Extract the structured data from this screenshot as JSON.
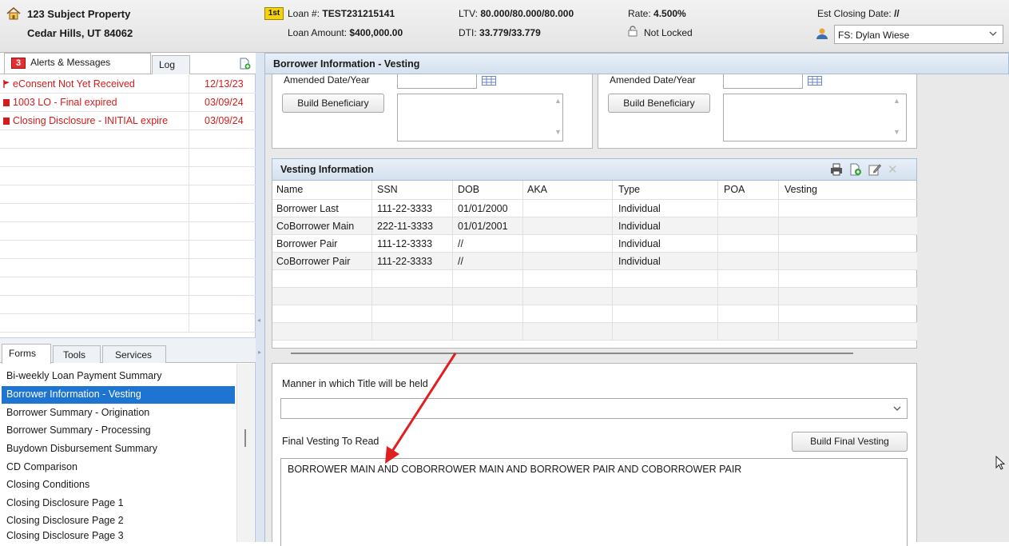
{
  "header": {
    "property_line1": "123 Subject Property",
    "property_line2": "Cedar Hills, UT 84062",
    "lien_badge": "1st",
    "loan_number_label": "Loan #:",
    "loan_number": "TEST231215141",
    "loan_amount_label": "Loan Amount:",
    "loan_amount": "$400,000.00",
    "ltv_label": "LTV:",
    "ltv": "80.000/80.000/80.000",
    "dti_label": "DTI:",
    "dti": "33.779/33.779",
    "rate_label": "Rate:",
    "rate": "4.500%",
    "lock_status": "Not Locked",
    "est_closing_label": "Est Closing Date:",
    "est_closing": "//",
    "user_select": "FS: Dylan Wiese"
  },
  "left_tabs": {
    "alerts_count": "3",
    "alerts_label": "Alerts & Messages",
    "log_label": "Log"
  },
  "alerts": [
    {
      "text": "eConsent Not Yet Received",
      "date": "12/13/23"
    },
    {
      "text": "1003 LO - Final expired",
      "date": "03/09/24"
    },
    {
      "text": "Closing Disclosure - INITIAL expire",
      "date": "03/09/24"
    }
  ],
  "bottom_tabs": {
    "forms": "Forms",
    "tools": "Tools",
    "services": "Services"
  },
  "forms": [
    "Bi-weekly Loan Payment Summary",
    "Borrower Information - Vesting",
    "Borrower Summary - Origination",
    "Borrower Summary - Processing",
    "Buydown Disbursement Summary",
    "CD Comparison",
    "Closing Conditions",
    "Closing Disclosure Page 1",
    "Closing Disclosure Page 2",
    "Closing Disclosure Page 3"
  ],
  "main": {
    "title": "Borrower Information - Vesting",
    "amended_label": "Amended Date/Year",
    "build_beneficiary": "Build Beneficiary",
    "vesting_title": "Vesting Information",
    "columns": [
      "Name",
      "SSN",
      "DOB",
      "AKA",
      "Type",
      "POA",
      "Vesting"
    ],
    "rows": [
      [
        "Borrower Last",
        "111-22-3333",
        "01/01/2000",
        "",
        "Individual",
        "",
        ""
      ],
      [
        "CoBorrower Main",
        "222-11-3333",
        "01/01/2001",
        "",
        "Individual",
        "",
        ""
      ],
      [
        "Borrower Pair",
        "111-12-3333",
        "//",
        "",
        "Individual",
        "",
        ""
      ],
      [
        "CoBorrower Pair",
        "111-22-3333",
        "//",
        "",
        "Individual",
        "",
        ""
      ]
    ],
    "manner_label": "Manner in which Title will be held",
    "manner_value": "",
    "final_vesting_label": "Final Vesting To Read",
    "build_final_vesting": "Build Final Vesting",
    "final_vesting_text": "BORROWER MAIN AND COBORROWER MAIN AND BORROWER PAIR AND COBORROWER PAIR"
  },
  "colors": {
    "alert_red": "#d41c1c",
    "selection_blue": "#1d74d1",
    "annotation_arrow": "#e02020"
  }
}
